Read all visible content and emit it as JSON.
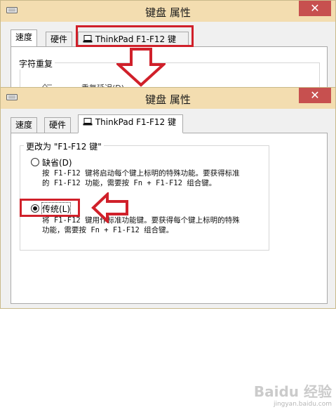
{
  "back_window": {
    "title": "键盘 属性",
    "close_label": "✕",
    "tabs": [
      "速度",
      "硬件",
      "ThinkPad F1-F12 键"
    ],
    "group_title": "字符重复",
    "partial_text": "重复延迟(D)"
  },
  "front_window": {
    "title": "键盘 属性",
    "close_label": "✕",
    "tabs": [
      "速度",
      "硬件",
      "ThinkPad F1-F12 键"
    ],
    "group_title": "更改为 \"F1-F12 键\"",
    "option_default": {
      "label": "缺省(D)",
      "checked": false,
      "desc_line1": "按 F1-F12 键将启动每个键上标明的特殊功能。要获得标准",
      "desc_line2": "的 F1-F12 功能，需要按 Fn + F1-F12 组合键。"
    },
    "option_legacy": {
      "label": "传统(L)",
      "checked": true,
      "desc_line1": "将 F1-F12 键用作标准功能键。要获得每个键上标明的特殊",
      "desc_line2": "功能，需要按 Fn + F1-F12 组合键。"
    }
  },
  "annotation_color": "#d0202a",
  "watermark": {
    "text": "Baidu 经验",
    "url": "jingyan.baidu.com"
  }
}
